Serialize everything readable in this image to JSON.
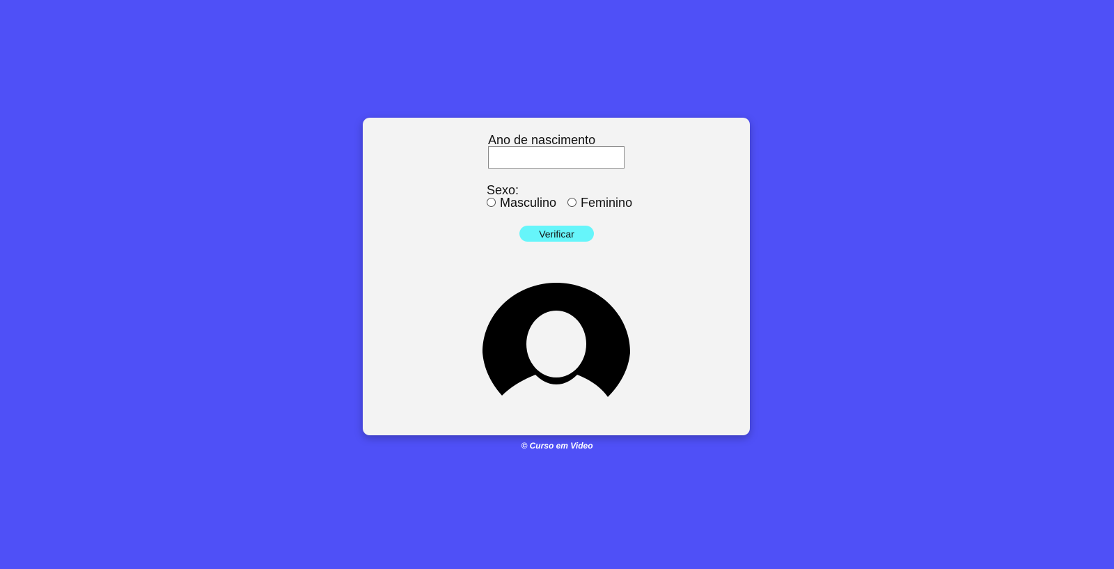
{
  "form": {
    "year_label": "Ano de nascimento",
    "year_value": "",
    "sex_label": "Sexo:",
    "sex_options": [
      "Masculino",
      "Feminino"
    ],
    "submit_label": "Verificar"
  },
  "result": {
    "image_icon": "user-avatar-icon"
  },
  "footer": {
    "copyright": "© Curso em Video"
  },
  "colors": {
    "background": "#4f50f7",
    "card": "#f3f3f3",
    "button": "#66f5fa"
  }
}
